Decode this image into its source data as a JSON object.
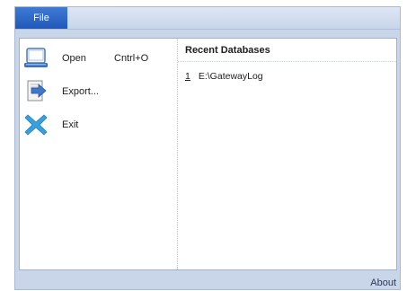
{
  "ribbon": {
    "file_tab_label": "File"
  },
  "backstage": {
    "commands": [
      {
        "label": "Open",
        "shortcut": "Cntrl+O",
        "icon": "open-database-icon"
      },
      {
        "label": "Export...",
        "icon": "export-icon"
      },
      {
        "label": "Exit",
        "icon": "exit-icon"
      }
    ],
    "recent": {
      "header": "Recent Databases",
      "items": [
        {
          "number": "1",
          "path": "E:\\GatewayLog"
        }
      ]
    }
  },
  "footer": {
    "about_label": "About"
  },
  "colors": {
    "file_tab": "#2a62c4",
    "frame": "#c9d6ea",
    "exit_icon": "#3aa0dc"
  }
}
